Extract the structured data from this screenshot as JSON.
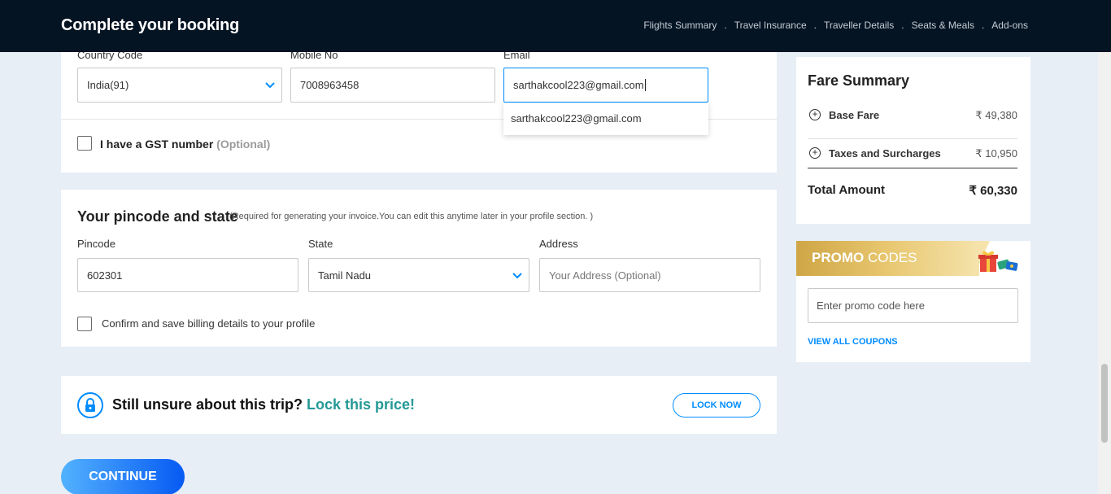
{
  "header": {
    "title": "Complete your booking",
    "steps": [
      "Flights Summary",
      "Travel Insurance",
      "Traveller Details",
      "Seats & Meals",
      "Add-ons"
    ],
    "separator": "."
  },
  "contact": {
    "country_code_label": "Country Code",
    "country_code_value": "India(91)",
    "mobile_label": "Mobile No",
    "mobile_value": "7008963458",
    "email_label": "Email",
    "email_value": "sarthakcool223@gmail.com",
    "email_suggestion": "sarthakcool223@gmail.com",
    "gst_label": "I have a GST number",
    "gst_optional": "(Optional)"
  },
  "pincode_section": {
    "title": "Your pincode and state",
    "note": "(Required for generating your invoice.You can edit this anytime later in your profile section. )",
    "pincode_label": "Pincode",
    "pincode_value": "602301",
    "state_label": "State",
    "state_value": "Tamil Nadu",
    "address_label": "Address",
    "address_placeholder": "Your Address (Optional)",
    "billing_confirm_label": "Confirm and save billing details to your profile"
  },
  "lock_price": {
    "question": "Still unsure about this trip?",
    "cta_text": "Lock this price!",
    "button_label": "LOCK NOW"
  },
  "continue_label": "CONTINUE",
  "fare_summary": {
    "title": "Fare Summary",
    "rows": [
      {
        "label": "Base Fare",
        "amount": "₹ 49,380"
      },
      {
        "label": "Taxes and Surcharges",
        "amount": "₹ 10,950"
      }
    ],
    "total_label": "Total Amount",
    "total_amount": "₹ 60,330"
  },
  "promo": {
    "title_bold": "PROMO",
    "title_rest": " CODES",
    "input_placeholder": "Enter promo code here",
    "view_all_label": "VIEW ALL COUPONS"
  },
  "colors": {
    "header_bg": "#051423",
    "accent_blue": "#008cff",
    "lock_green": "#249995",
    "page_bg": "#e7eef6"
  },
  "icons": [
    "chevron-down-icon",
    "lock-icon",
    "plus-circle-icon",
    "gift-icon"
  ]
}
